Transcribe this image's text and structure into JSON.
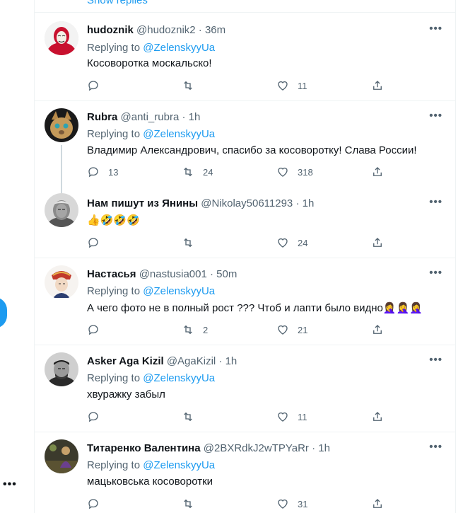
{
  "show_replies": "Show replies",
  "replying_to_label": "Replying to",
  "tweets": [
    {
      "name": "hudoznik",
      "handle": "@hudoznik2",
      "time": "36m",
      "replying_to": "@ZelenskyyUa",
      "text": "Косоворотка москальско!",
      "replies": "",
      "retweets": "",
      "likes": "11"
    },
    {
      "name": "Rubra",
      "handle": "@anti_rubra",
      "time": "1h",
      "replying_to": "@ZelenskyyUa",
      "text": "Владимир Александрович, спасибо за косоворотку! Слава России!",
      "replies": "13",
      "retweets": "24",
      "likes": "318"
    },
    {
      "name": "Нам пишут из Янины",
      "handle": "@Nikolay50611293",
      "time": "1h",
      "replying_to": "",
      "text": "👍🤣🤣🤣",
      "replies": "",
      "retweets": "",
      "likes": "24"
    },
    {
      "name": "Настасья",
      "handle": "@nastusia001",
      "time": "50m",
      "replying_to": "@ZelenskyyUa",
      "text": "А чего фото не в полный рост ??? Чтоб и лапти было видно🤦‍♀️🤦‍♀️🤦‍♀️",
      "replies": "",
      "retweets": "2",
      "likes": "21"
    },
    {
      "name": "Asker Aga Kizil",
      "handle": "@AgaKizil",
      "time": "1h",
      "replying_to": "@ZelenskyyUa",
      "text": "хвуражку забыл",
      "replies": "",
      "retweets": "",
      "likes": "11"
    },
    {
      "name": "Титаренко Валентина",
      "handle": "@2BXRdkJ2wTPYaRr",
      "time": "1h",
      "replying_to": "@ZelenskyyUa",
      "text": "мацьковська косоворотки",
      "replies": "",
      "retweets": "",
      "likes": "31"
    }
  ],
  "colors": {
    "accent": "#1d9bf0",
    "muted": "#536471",
    "text": "#0f1419",
    "divider": "#eff3f4"
  },
  "icons": [
    "reply-icon",
    "retweet-icon",
    "like-icon",
    "share-icon",
    "more-icon"
  ]
}
